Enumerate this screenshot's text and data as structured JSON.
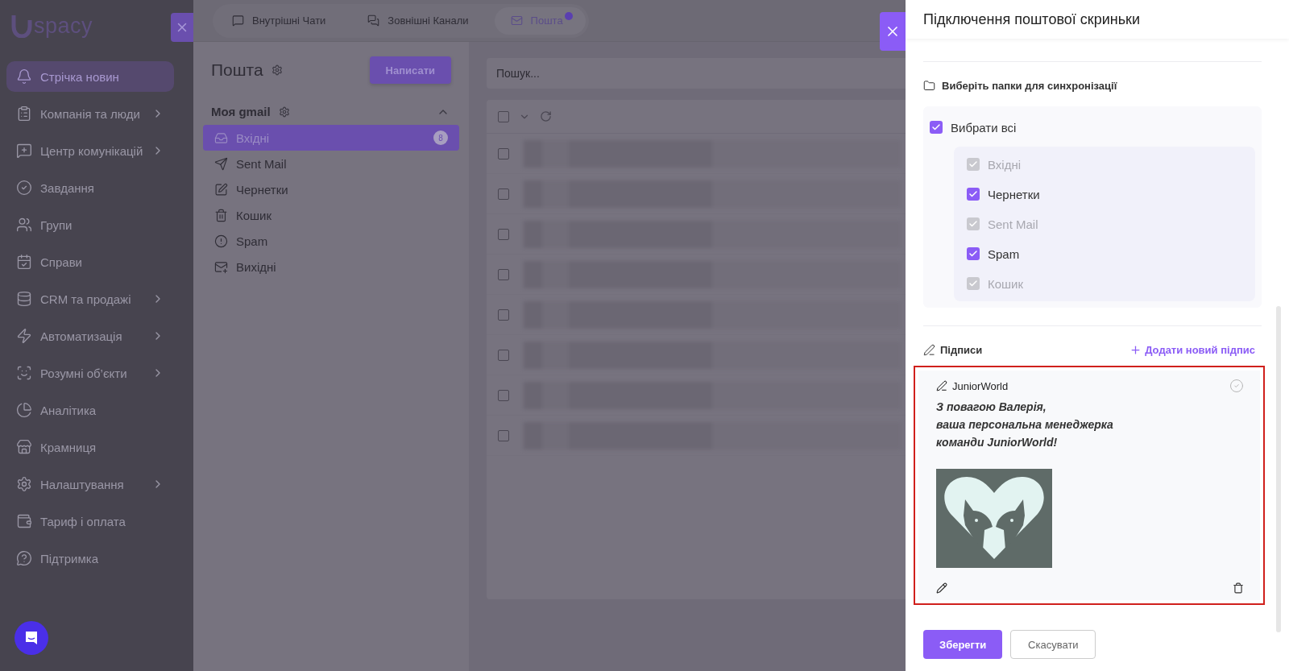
{
  "sidebar": {
    "logo": "spacy",
    "items": [
      {
        "label": "Стрічка новин",
        "selected": true,
        "expandable": false
      },
      {
        "label": "Компанія та люди",
        "selected": false,
        "expandable": true
      },
      {
        "label": "Центр комунікацій",
        "selected": false,
        "expandable": true
      },
      {
        "label": "Завдання",
        "selected": false,
        "expandable": false
      },
      {
        "label": "Групи",
        "selected": false,
        "expandable": false
      },
      {
        "label": "Справи",
        "selected": false,
        "expandable": false
      },
      {
        "label": "CRM та продажі",
        "selected": false,
        "expandable": true
      },
      {
        "label": "Автоматизація",
        "selected": false,
        "expandable": true
      },
      {
        "label": "Розумні об’єкти",
        "selected": false,
        "expandable": true
      },
      {
        "label": "Аналітика",
        "selected": false,
        "expandable": false
      },
      {
        "label": "Крамниця",
        "selected": false,
        "expandable": false
      },
      {
        "label": "Налаштування",
        "selected": false,
        "expandable": true
      },
      {
        "label": "Тариф і оплата",
        "selected": false,
        "expandable": false
      },
      {
        "label": "Підтримка",
        "selected": false,
        "expandable": false
      }
    ]
  },
  "top_tabs": [
    {
      "label": "Внутрішні Чати",
      "selected": false,
      "notification": false
    },
    {
      "label": "Зовнішні Канали",
      "selected": false,
      "notification": false
    },
    {
      "label": "Пошта",
      "selected": true,
      "notification": true
    }
  ],
  "mail_panel": {
    "title": "Пошта",
    "compose_button": "Написати",
    "account": {
      "name": "Моя gmail",
      "expanded": true
    },
    "folders": [
      {
        "label": "Вхідні",
        "selected": true,
        "count": "8"
      },
      {
        "label": "Sent Mail",
        "selected": false
      },
      {
        "label": "Чернетки",
        "selected": false
      },
      {
        "label": "Кошик",
        "selected": false
      },
      {
        "label": "Spam",
        "selected": false
      },
      {
        "label": "Вихідні",
        "selected": false
      }
    ]
  },
  "message_list": {
    "search_placeholder": "Пошук...",
    "select_all_checked": false,
    "rows": [
      {
        "checked": false
      },
      {
        "checked": false
      },
      {
        "checked": false
      },
      {
        "checked": false
      },
      {
        "checked": false
      },
      {
        "checked": false
      },
      {
        "checked": false
      },
      {
        "checked": false
      }
    ]
  },
  "drawer": {
    "title": "Підключення поштової скриньки",
    "folders_section": {
      "label": "Виберіть папки для синхронізації",
      "select_all": {
        "label": "Вибрати всі",
        "checked": true
      },
      "folders": [
        {
          "label": "Вхідні",
          "checked": true,
          "disabled": true
        },
        {
          "label": "Чернетки",
          "checked": true,
          "disabled": false
        },
        {
          "label": "Sent Mail",
          "checked": true,
          "disabled": true
        },
        {
          "label": "Spam",
          "checked": true,
          "disabled": false
        },
        {
          "label": "Кошик",
          "checked": true,
          "disabled": true
        }
      ]
    },
    "signatures": {
      "label": "Підписи",
      "add_link": "Додати новий підпис",
      "items": [
        {
          "name": "JuniorWorld",
          "default": false,
          "highlighted": true,
          "lines": [
            "З повагою Валерія,",
            "ваша персональна менеджерка",
            "команди JuniorWorld!"
          ]
        }
      ]
    },
    "buttons": [
      {
        "label": "Зберегти",
        "kind": "primary"
      },
      {
        "label": "Скасувати",
        "kind": "secondary"
      }
    ]
  }
}
